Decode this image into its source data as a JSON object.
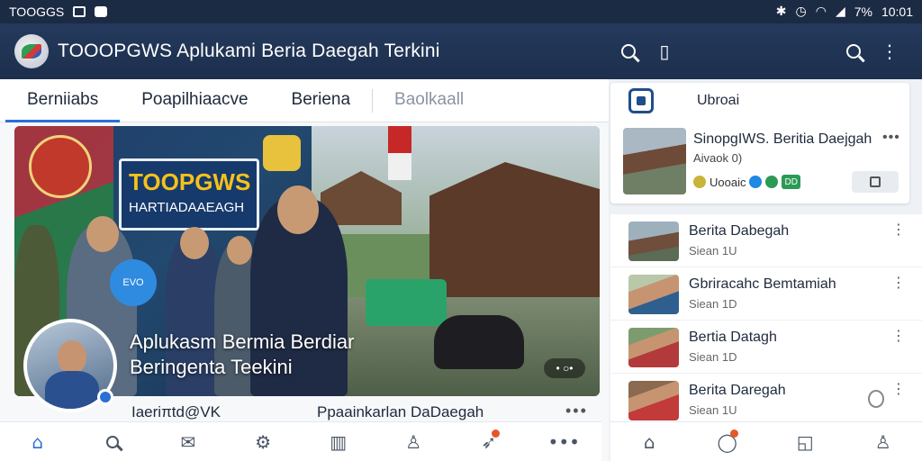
{
  "status_bar": {
    "app_name": "TOOGGS",
    "battery": "7%",
    "time": "10:01",
    "icons": [
      "image-icon",
      "notification-icon",
      "bluetooth-icon",
      "alarm-icon",
      "wifi-icon",
      "signal-icon",
      "battery-icon"
    ]
  },
  "app_bar": {
    "title": "TOOOPGWS Aplukami Beria Daegah Terkini",
    "icons": [
      "search-icon",
      "bookmark-icon",
      "search-icon",
      "overflow-menu-icon"
    ]
  },
  "tabs": [
    {
      "label": "Berniiabs",
      "active": true
    },
    {
      "label": "Poapilhiaacve",
      "active": false
    },
    {
      "label": "Beriena",
      "active": false
    },
    {
      "label": "Baolkaall",
      "active": false,
      "muted": true
    }
  ],
  "hero": {
    "sign_brand": "TOOPGWS",
    "sign_subtitle": "HARTIADAAEAGH",
    "badge_text": "EVO",
    "overlay_title_1": "Aplukasm Bermia Berdiar",
    "overlay_title_2": "Beringenta Teekini",
    "dots": "• ○•",
    "footer_left": "Ιaeriπtd@VK",
    "footer_right": "Ρpaainkarlan DaDaegah",
    "more": "•••"
  },
  "featured_card": {
    "header_label": "Ubroai",
    "title": "SinopgIWS. Beritia Daejgah",
    "subtitle": "Aivaok 0)",
    "chip_label": "Uooaic",
    "chip_box": "DD",
    "more": "•••"
  },
  "list_items": [
    {
      "title": "Berita Dabegah",
      "subtitle": "Siean 1U"
    },
    {
      "title": "Gbriracahc Bemtamiah",
      "subtitle": "Siean 1D"
    },
    {
      "title": "Bertia Datagh",
      "subtitle": "Siean 1D"
    },
    {
      "title": "Berita Daregah",
      "subtitle": "Siean 1U"
    }
  ],
  "bottom_nav": {
    "items": [
      "home-icon",
      "search-icon",
      "mail-icon",
      "puzzle-icon",
      "chart-icon",
      "user-swap-icon",
      "rocket-icon",
      "more-icon"
    ],
    "active": "home-icon"
  },
  "right_nav": {
    "items": [
      "home-icon",
      "chat-icon",
      "edit-box-icon",
      "profile-icon"
    ]
  },
  "colors": {
    "app_bar": "#1d2f4d",
    "accent": "#2a6fd6",
    "notification": "#e5572b"
  }
}
